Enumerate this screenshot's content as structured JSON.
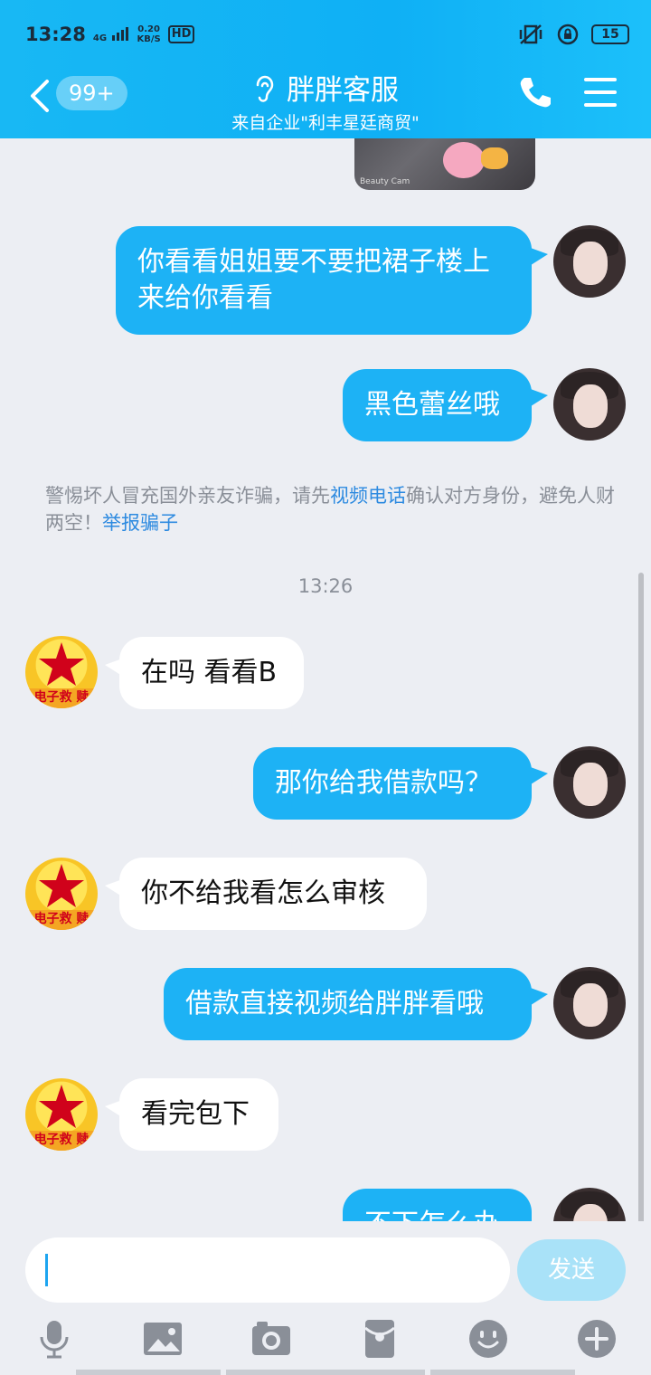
{
  "status_bar": {
    "time": "13:28",
    "network": "4G",
    "speed_value": "0.20",
    "speed_unit": "KB/S",
    "hd": "HD",
    "battery": "15"
  },
  "header": {
    "unread_badge": "99+",
    "title": "胖胖客服",
    "subtitle": "来自企业\"利丰星廷商贸\""
  },
  "image_watermark": "Beauty Cam",
  "messages": [
    {
      "side": "out",
      "text": "你看看姐姐要不要把裙子楼上来给你看看"
    },
    {
      "side": "out",
      "text": "黑色蕾丝哦"
    },
    {
      "side": "in",
      "text": "在吗 看看B"
    },
    {
      "side": "out",
      "text": "那你给我借款吗？"
    },
    {
      "side": "in",
      "text": "你不给我看怎么审核"
    },
    {
      "side": "out",
      "text": "借款直接视频给胖胖看哦"
    },
    {
      "side": "in",
      "text": "看完包下"
    },
    {
      "side": "out",
      "text": "不下怎么办"
    }
  ],
  "warning": {
    "part1": "警惕坏人冒充国外亲友诈骗，请先",
    "link1": "视频电话",
    "part2": "确认对方身份，避免人财两空！",
    "link2": "举报骗子"
  },
  "time_separator": "13:26",
  "other_avatar_text": "电子救 赎",
  "input": {
    "value": "",
    "send_label": "发送"
  },
  "toolbar_icons": [
    "microphone-icon",
    "image-icon",
    "camera-icon",
    "red-packet-icon",
    "emoji-icon",
    "plus-icon"
  ],
  "colors": {
    "header_bg": "#18b8f4",
    "bubble_out": "#1db2f5",
    "bubble_in": "#ffffff",
    "link": "#2d8ae0",
    "send_disabled": "#a9e2f8"
  }
}
